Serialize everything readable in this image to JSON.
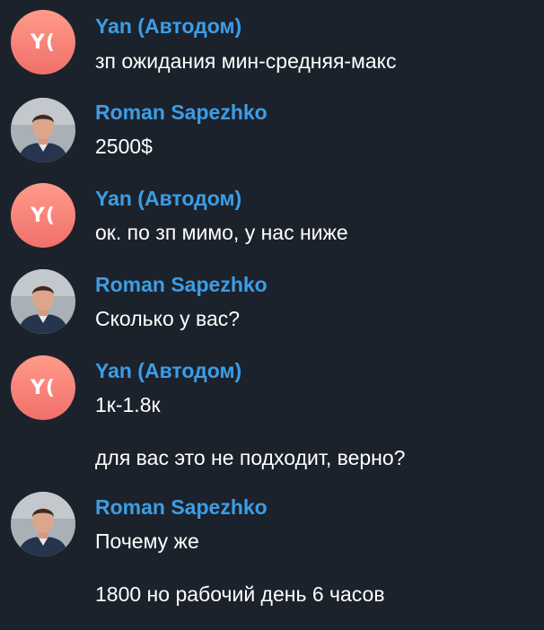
{
  "messages": [
    {
      "sender": "Yan (Автодом)",
      "avatar_initials": "Y(",
      "avatar_icon": "initials-avatar",
      "lines": [
        "зп ожидания мин-средняя-макс"
      ]
    },
    {
      "sender": "Roman Sapezhko",
      "avatar_icon": "user-photo-avatar",
      "lines": [
        "2500$"
      ]
    },
    {
      "sender": "Yan (Автодом)",
      "avatar_initials": "Y(",
      "avatar_icon": "initials-avatar",
      "lines": [
        "ок. по зп мимо, у нас ниже"
      ]
    },
    {
      "sender": "Roman Sapezhko",
      "avatar_icon": "user-photo-avatar",
      "lines": [
        "Сколько у вас?"
      ]
    },
    {
      "sender": "Yan (Автодом)",
      "avatar_initials": "Y(",
      "avatar_icon": "initials-avatar",
      "lines": [
        "1к-1.8к",
        "для вас это не подходит, верно?"
      ]
    },
    {
      "sender": "Roman Sapezhko",
      "avatar_icon": "user-photo-avatar",
      "lines": [
        "Почему же",
        "1800 но рабочий день 6 часов"
      ]
    }
  ],
  "colors": {
    "background": "#1b222c",
    "sender_name": "#3d9de6",
    "message_text": "#ffffff",
    "avatar_gradient_top": "#ff9a8a",
    "avatar_gradient_bottom": "#f0706a"
  }
}
